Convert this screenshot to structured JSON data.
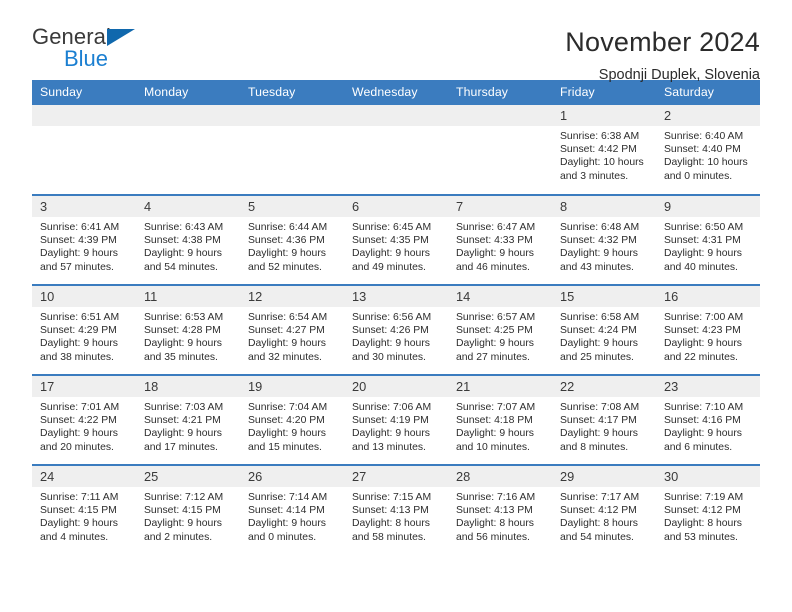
{
  "logo": {
    "word_one": "General",
    "word_two": "Blue",
    "triangle_color": "#1068ad",
    "blue_color": "#1b7fd1"
  },
  "header": {
    "title": "November 2024",
    "subtitle": "Spodnji Duplek, Slovenia",
    "header_bg": "#3b7cbf",
    "daynum_bg": "#efefef"
  },
  "weekdays": [
    "Sunday",
    "Monday",
    "Tuesday",
    "Wednesday",
    "Thursday",
    "Friday",
    "Saturday"
  ],
  "labels": {
    "sunrise": "Sunrise:",
    "sunset": "Sunset:",
    "daylight": "Daylight:"
  },
  "weeks": [
    [
      {
        "day": "",
        "empty": true
      },
      {
        "day": "",
        "empty": true
      },
      {
        "day": "",
        "empty": true
      },
      {
        "day": "",
        "empty": true
      },
      {
        "day": "",
        "empty": true
      },
      {
        "day": "1",
        "sunrise": "Sunrise: 6:38 AM",
        "sunset": "Sunset: 4:42 PM",
        "daylight": "Daylight: 10 hours and 3 minutes."
      },
      {
        "day": "2",
        "sunrise": "Sunrise: 6:40 AM",
        "sunset": "Sunset: 4:40 PM",
        "daylight": "Daylight: 10 hours and 0 minutes."
      }
    ],
    [
      {
        "day": "3",
        "sunrise": "Sunrise: 6:41 AM",
        "sunset": "Sunset: 4:39 PM",
        "daylight": "Daylight: 9 hours and 57 minutes."
      },
      {
        "day": "4",
        "sunrise": "Sunrise: 6:43 AM",
        "sunset": "Sunset: 4:38 PM",
        "daylight": "Daylight: 9 hours and 54 minutes."
      },
      {
        "day": "5",
        "sunrise": "Sunrise: 6:44 AM",
        "sunset": "Sunset: 4:36 PM",
        "daylight": "Daylight: 9 hours and 52 minutes."
      },
      {
        "day": "6",
        "sunrise": "Sunrise: 6:45 AM",
        "sunset": "Sunset: 4:35 PM",
        "daylight": "Daylight: 9 hours and 49 minutes."
      },
      {
        "day": "7",
        "sunrise": "Sunrise: 6:47 AM",
        "sunset": "Sunset: 4:33 PM",
        "daylight": "Daylight: 9 hours and 46 minutes."
      },
      {
        "day": "8",
        "sunrise": "Sunrise: 6:48 AM",
        "sunset": "Sunset: 4:32 PM",
        "daylight": "Daylight: 9 hours and 43 minutes."
      },
      {
        "day": "9",
        "sunrise": "Sunrise: 6:50 AM",
        "sunset": "Sunset: 4:31 PM",
        "daylight": "Daylight: 9 hours and 40 minutes."
      }
    ],
    [
      {
        "day": "10",
        "sunrise": "Sunrise: 6:51 AM",
        "sunset": "Sunset: 4:29 PM",
        "daylight": "Daylight: 9 hours and 38 minutes."
      },
      {
        "day": "11",
        "sunrise": "Sunrise: 6:53 AM",
        "sunset": "Sunset: 4:28 PM",
        "daylight": "Daylight: 9 hours and 35 minutes."
      },
      {
        "day": "12",
        "sunrise": "Sunrise: 6:54 AM",
        "sunset": "Sunset: 4:27 PM",
        "daylight": "Daylight: 9 hours and 32 minutes."
      },
      {
        "day": "13",
        "sunrise": "Sunrise: 6:56 AM",
        "sunset": "Sunset: 4:26 PM",
        "daylight": "Daylight: 9 hours and 30 minutes."
      },
      {
        "day": "14",
        "sunrise": "Sunrise: 6:57 AM",
        "sunset": "Sunset: 4:25 PM",
        "daylight": "Daylight: 9 hours and 27 minutes."
      },
      {
        "day": "15",
        "sunrise": "Sunrise: 6:58 AM",
        "sunset": "Sunset: 4:24 PM",
        "daylight": "Daylight: 9 hours and 25 minutes."
      },
      {
        "day": "16",
        "sunrise": "Sunrise: 7:00 AM",
        "sunset": "Sunset: 4:23 PM",
        "daylight": "Daylight: 9 hours and 22 minutes."
      }
    ],
    [
      {
        "day": "17",
        "sunrise": "Sunrise: 7:01 AM",
        "sunset": "Sunset: 4:22 PM",
        "daylight": "Daylight: 9 hours and 20 minutes."
      },
      {
        "day": "18",
        "sunrise": "Sunrise: 7:03 AM",
        "sunset": "Sunset: 4:21 PM",
        "daylight": "Daylight: 9 hours and 17 minutes."
      },
      {
        "day": "19",
        "sunrise": "Sunrise: 7:04 AM",
        "sunset": "Sunset: 4:20 PM",
        "daylight": "Daylight: 9 hours and 15 minutes."
      },
      {
        "day": "20",
        "sunrise": "Sunrise: 7:06 AM",
        "sunset": "Sunset: 4:19 PM",
        "daylight": "Daylight: 9 hours and 13 minutes."
      },
      {
        "day": "21",
        "sunrise": "Sunrise: 7:07 AM",
        "sunset": "Sunset: 4:18 PM",
        "daylight": "Daylight: 9 hours and 10 minutes."
      },
      {
        "day": "22",
        "sunrise": "Sunrise: 7:08 AM",
        "sunset": "Sunset: 4:17 PM",
        "daylight": "Daylight: 9 hours and 8 minutes."
      },
      {
        "day": "23",
        "sunrise": "Sunrise: 7:10 AM",
        "sunset": "Sunset: 4:16 PM",
        "daylight": "Daylight: 9 hours and 6 minutes."
      }
    ],
    [
      {
        "day": "24",
        "sunrise": "Sunrise: 7:11 AM",
        "sunset": "Sunset: 4:15 PM",
        "daylight": "Daylight: 9 hours and 4 minutes."
      },
      {
        "day": "25",
        "sunrise": "Sunrise: 7:12 AM",
        "sunset": "Sunset: 4:15 PM",
        "daylight": "Daylight: 9 hours and 2 minutes."
      },
      {
        "day": "26",
        "sunrise": "Sunrise: 7:14 AM",
        "sunset": "Sunset: 4:14 PM",
        "daylight": "Daylight: 9 hours and 0 minutes."
      },
      {
        "day": "27",
        "sunrise": "Sunrise: 7:15 AM",
        "sunset": "Sunset: 4:13 PM",
        "daylight": "Daylight: 8 hours and 58 minutes."
      },
      {
        "day": "28",
        "sunrise": "Sunrise: 7:16 AM",
        "sunset": "Sunset: 4:13 PM",
        "daylight": "Daylight: 8 hours and 56 minutes."
      },
      {
        "day": "29",
        "sunrise": "Sunrise: 7:17 AM",
        "sunset": "Sunset: 4:12 PM",
        "daylight": "Daylight: 8 hours and 54 minutes."
      },
      {
        "day": "30",
        "sunrise": "Sunrise: 7:19 AM",
        "sunset": "Sunset: 4:12 PM",
        "daylight": "Daylight: 8 hours and 53 minutes."
      }
    ]
  ]
}
